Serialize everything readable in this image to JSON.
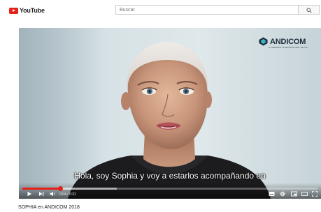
{
  "masthead": {
    "logo_text": "YouTube",
    "search_placeholder": "Buscar",
    "search_icon": "search-icon"
  },
  "player": {
    "channel_logo_text": "ANDICOM",
    "channel_logo_sub": "CONGRESO INTERNACIONAL DE TIC",
    "subtitle": "Hola, soy Sophia y voy a estarlos acompañando en",
    "time_display": "0:04 / 0:31",
    "progress_played": 0.13,
    "progress_loaded": 0.32,
    "controls": {
      "play": "play-icon",
      "next": "next-icon",
      "volume": "volume-icon",
      "subtitles": "subtitles-icon",
      "settings": "gear-icon",
      "miniplayer": "miniplayer-icon",
      "theater": "theater-icon",
      "fullscreen": "fullscreen-icon"
    }
  },
  "video_title": "SOPHIA en ANDICOM 2018",
  "colors": {
    "brand_red": "#e62117",
    "search_border": "#cccccc",
    "title_text": "#222222"
  }
}
